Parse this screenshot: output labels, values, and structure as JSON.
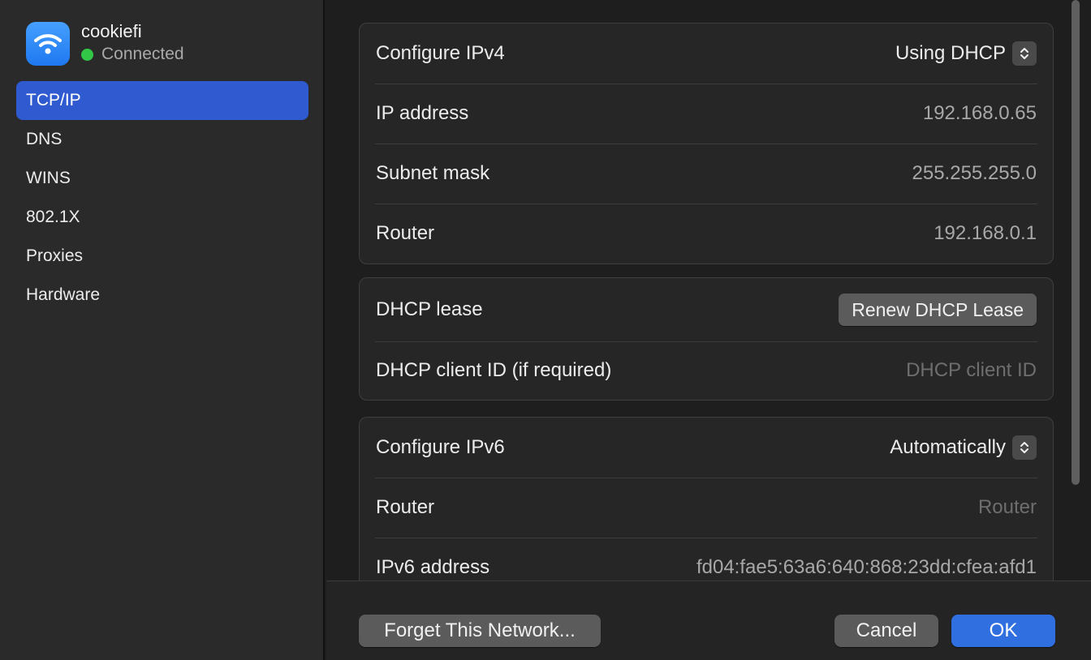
{
  "network": {
    "name": "cookiefi",
    "status": "Connected",
    "status_color": "#33c748",
    "icon": "wifi-icon"
  },
  "sidebar": {
    "items": [
      {
        "label": "TCP/IP",
        "selected": true
      },
      {
        "label": "DNS",
        "selected": false
      },
      {
        "label": "WINS",
        "selected": false
      },
      {
        "label": "802.1X",
        "selected": false
      },
      {
        "label": "Proxies",
        "selected": false
      },
      {
        "label": "Hardware",
        "selected": false
      }
    ]
  },
  "ipv4": {
    "configure_label": "Configure IPv4",
    "configure_value": "Using DHCP",
    "ip_label": "IP address",
    "ip_value": "192.168.0.65",
    "subnet_label": "Subnet mask",
    "subnet_value": "255.255.255.0",
    "router_label": "Router",
    "router_value": "192.168.0.1"
  },
  "dhcp": {
    "lease_label": "DHCP lease",
    "renew_button": "Renew DHCP Lease",
    "client_id_label": "DHCP client ID (if required)",
    "client_id_placeholder": "DHCP client ID",
    "client_id_value": ""
  },
  "ipv6": {
    "configure_label": "Configure IPv6",
    "configure_value": "Automatically",
    "router_label": "Router",
    "router_placeholder": "Router",
    "address_label": "IPv6 address",
    "address_value": "fd04:fae5:63a6:640:868:23dd:cfea:afd1"
  },
  "footer": {
    "forget_button": "Forget This Network...",
    "cancel_button": "Cancel",
    "ok_button": "OK"
  },
  "colors": {
    "accent": "#2f6fe0",
    "sidebar_selection": "#2f5ad0",
    "background": "#1e1e1e"
  }
}
